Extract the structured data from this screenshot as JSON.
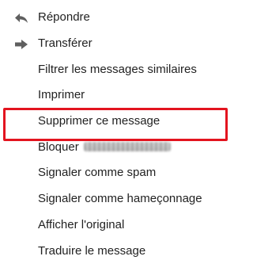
{
  "menu": {
    "items": [
      {
        "label": "Répondre",
        "icon": "reply-icon"
      },
      {
        "label": "Transférer",
        "icon": "forward-icon"
      },
      {
        "label": "Filtrer les messages similaires"
      },
      {
        "label": "Imprimer"
      },
      {
        "label": "Supprimer ce message"
      },
      {
        "label": "Bloquer",
        "highlighted": true,
        "redacted_name": true
      },
      {
        "label": "Signaler comme spam"
      },
      {
        "label": "Signaler comme hameçonnage"
      },
      {
        "label": "Afficher l'original"
      },
      {
        "label": "Traduire le message"
      }
    ]
  },
  "colors": {
    "highlight": "#e3141f",
    "icon": "#5f5f5f",
    "text": "#222222"
  }
}
